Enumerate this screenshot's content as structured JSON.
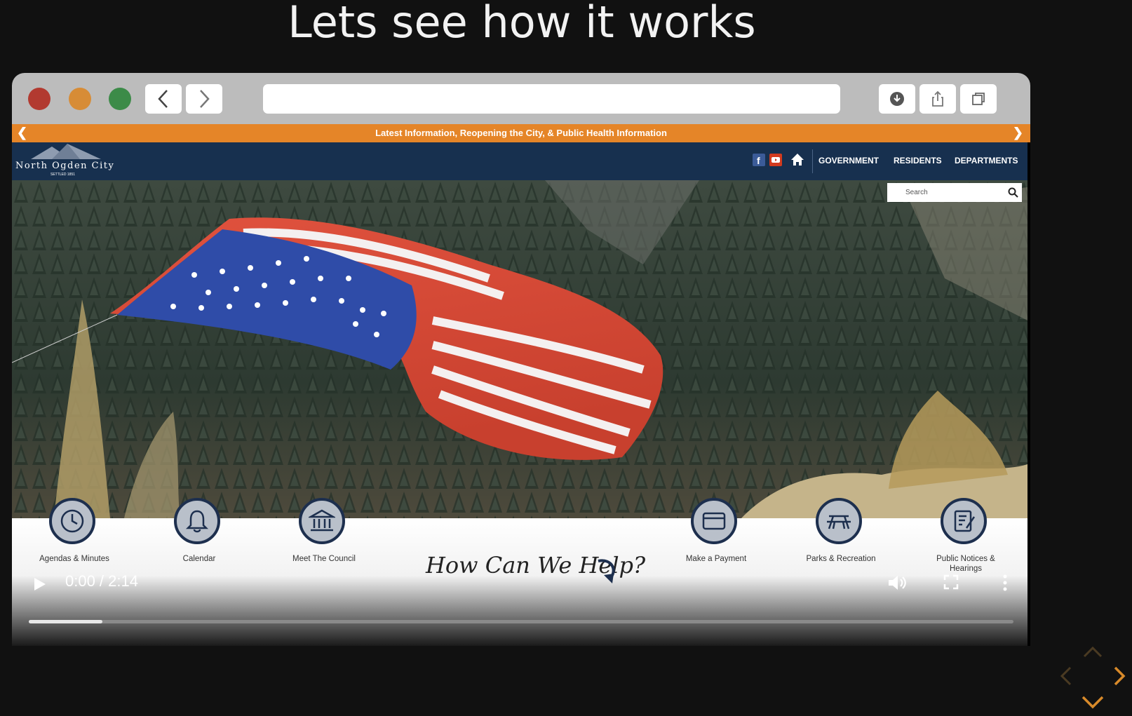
{
  "slide": {
    "title": "Lets see how it works"
  },
  "browser": {
    "address_value": ""
  },
  "site": {
    "banner_text": "Latest Information, Reopening the City, & Public Health Information",
    "logo_name": "North Ogden City",
    "logo_settled": "SETTLED 1851",
    "nav": [
      "GOVERNMENT",
      "RESIDENTS",
      "DEPARTMENTS"
    ],
    "search_placeholder": "Search",
    "help_title": "How Can We Help?",
    "quick_links": [
      {
        "label": "Agendas & Minutes",
        "icon": "clock-icon"
      },
      {
        "label": "Calendar",
        "icon": "bell-icon"
      },
      {
        "label": "Meet The Council",
        "icon": "capitol-icon"
      },
      {
        "label": "Make a Payment",
        "icon": "card-icon"
      },
      {
        "label": "Parks & Recreation",
        "icon": "picnic-table-icon"
      },
      {
        "label": "Public Notices & Hearings",
        "icon": "notice-icon"
      }
    ]
  },
  "player": {
    "time": "0:00 / 2:14",
    "progress_fraction": 0.075
  },
  "colors": {
    "banner": "#e58528",
    "header": "#17304f",
    "icon_ring": "#1d2f4e",
    "slide_nav": "#d88a2a"
  }
}
